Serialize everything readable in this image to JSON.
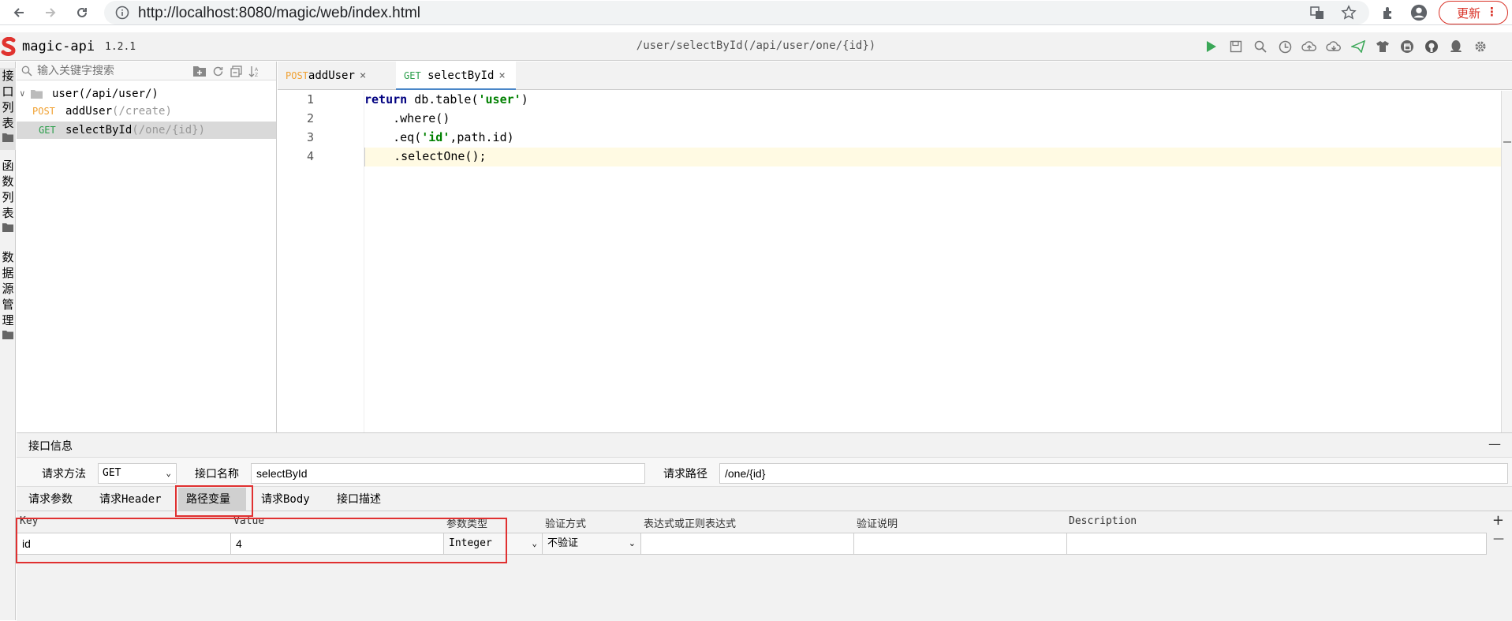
{
  "browser": {
    "url": "http://localhost:8080/magic/web/index.html",
    "update_label": "更新",
    "menu_dots": "⋮"
  },
  "app": {
    "name": "magic-api",
    "version": "1.2.1",
    "header_path": "/user/selectById(/api/user/one/{id})"
  },
  "vtabs": [
    {
      "label": [
        "接",
        "口",
        "列",
        "表"
      ]
    },
    {
      "label": [
        "函",
        "数",
        "列",
        "表"
      ]
    },
    {
      "label": [
        "数",
        "据",
        "源",
        "管",
        "理"
      ]
    }
  ],
  "tree": {
    "search_placeholder": "输入关键字搜索",
    "group": {
      "name": "user",
      "path": "(/api/user/)"
    },
    "items": [
      {
        "method": "POST",
        "name": "addUser",
        "path": "(/create)"
      },
      {
        "method": "GET",
        "name": "selectById",
        "path": "(/one/{id})"
      }
    ]
  },
  "editor_tabs": [
    {
      "method": "POST",
      "name": "addUser",
      "close": "×"
    },
    {
      "method": "GET",
      "name": "selectById",
      "close": "×"
    }
  ],
  "code": {
    "line_numbers": [
      "1",
      "2",
      "3",
      "4"
    ],
    "l1_kw": "return",
    "l1_a": " db.table(",
    "l1_str": "'user'",
    "l1_b": ")",
    "l2": "    .where()",
    "l3_a": "    .eq(",
    "l3_str": "'id'",
    "l3_b": ",path.id)",
    "l4": "    .selectOne();"
  },
  "panel": {
    "title": "接口信息",
    "minimize": "—",
    "method_label": "请求方法",
    "method_value": "GET",
    "name_label": "接口名称",
    "name_value": "selectById",
    "path_label": "请求路径",
    "path_value": "/one/{id}",
    "subtabs": [
      "请求参数",
      "请求Header",
      "路径变量",
      "请求Body",
      "接口描述"
    ],
    "grid_headers": [
      "Key",
      "Value",
      "参数类型",
      "验证方式",
      "表达式或正则表达式",
      "验证说明",
      "Description"
    ],
    "row": {
      "key": "id",
      "value": "4",
      "type": "Integer",
      "validation": "不验证",
      "expr": "",
      "note": "",
      "desc": ""
    },
    "add": "+",
    "remove": "—"
  }
}
